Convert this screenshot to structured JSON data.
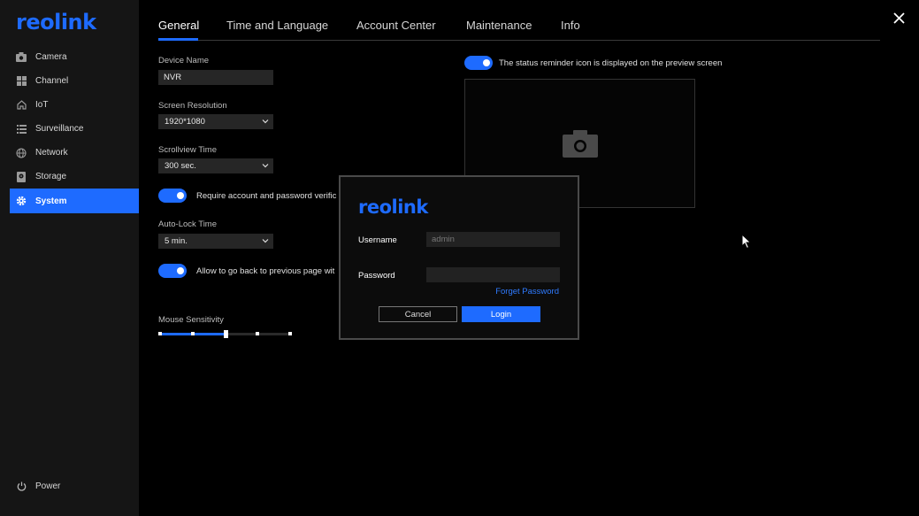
{
  "brand": {
    "logo": "reolink",
    "accent": "#1e6bff"
  },
  "sidebar": {
    "items": [
      {
        "label": "Camera",
        "icon": "camera-icon"
      },
      {
        "label": "Channel",
        "icon": "grid-icon"
      },
      {
        "label": "IoT",
        "icon": "home-icon"
      },
      {
        "label": "Surveillance",
        "icon": "list-icon"
      },
      {
        "label": "Network",
        "icon": "globe-icon"
      },
      {
        "label": "Storage",
        "icon": "storage-icon"
      },
      {
        "label": "System",
        "icon": "gear-icon",
        "active": true
      }
    ],
    "power": "Power"
  },
  "tabs": [
    "General",
    "Time and Language",
    "Account Center",
    "Maintenance",
    "Info"
  ],
  "general": {
    "device_name_label": "Device Name",
    "device_name_value": "NVR",
    "screen_resolution_label": "Screen Resolution",
    "screen_resolution_value": "1920*1080",
    "scrollview_label": "Scrollview Time",
    "scrollview_value": "300 sec.",
    "require_account_text": "Require account and password verific",
    "auto_lock_label": "Auto-Lock Time",
    "auto_lock_value": "5 min.",
    "go_back_text": "Allow to go back to previous page wit",
    "mouse_sensitivity_label": "Mouse Sensitivity",
    "mouse_sensitivity_level": 0.5,
    "status_reminder_text": "The status reminder icon is displayed on the preview screen"
  },
  "login_dialog": {
    "logo": "reolink",
    "username_label": "Username",
    "username_placeholder": "admin",
    "password_label": "Password",
    "forget_password": "Forget Password",
    "cancel": "Cancel",
    "login": "Login"
  }
}
